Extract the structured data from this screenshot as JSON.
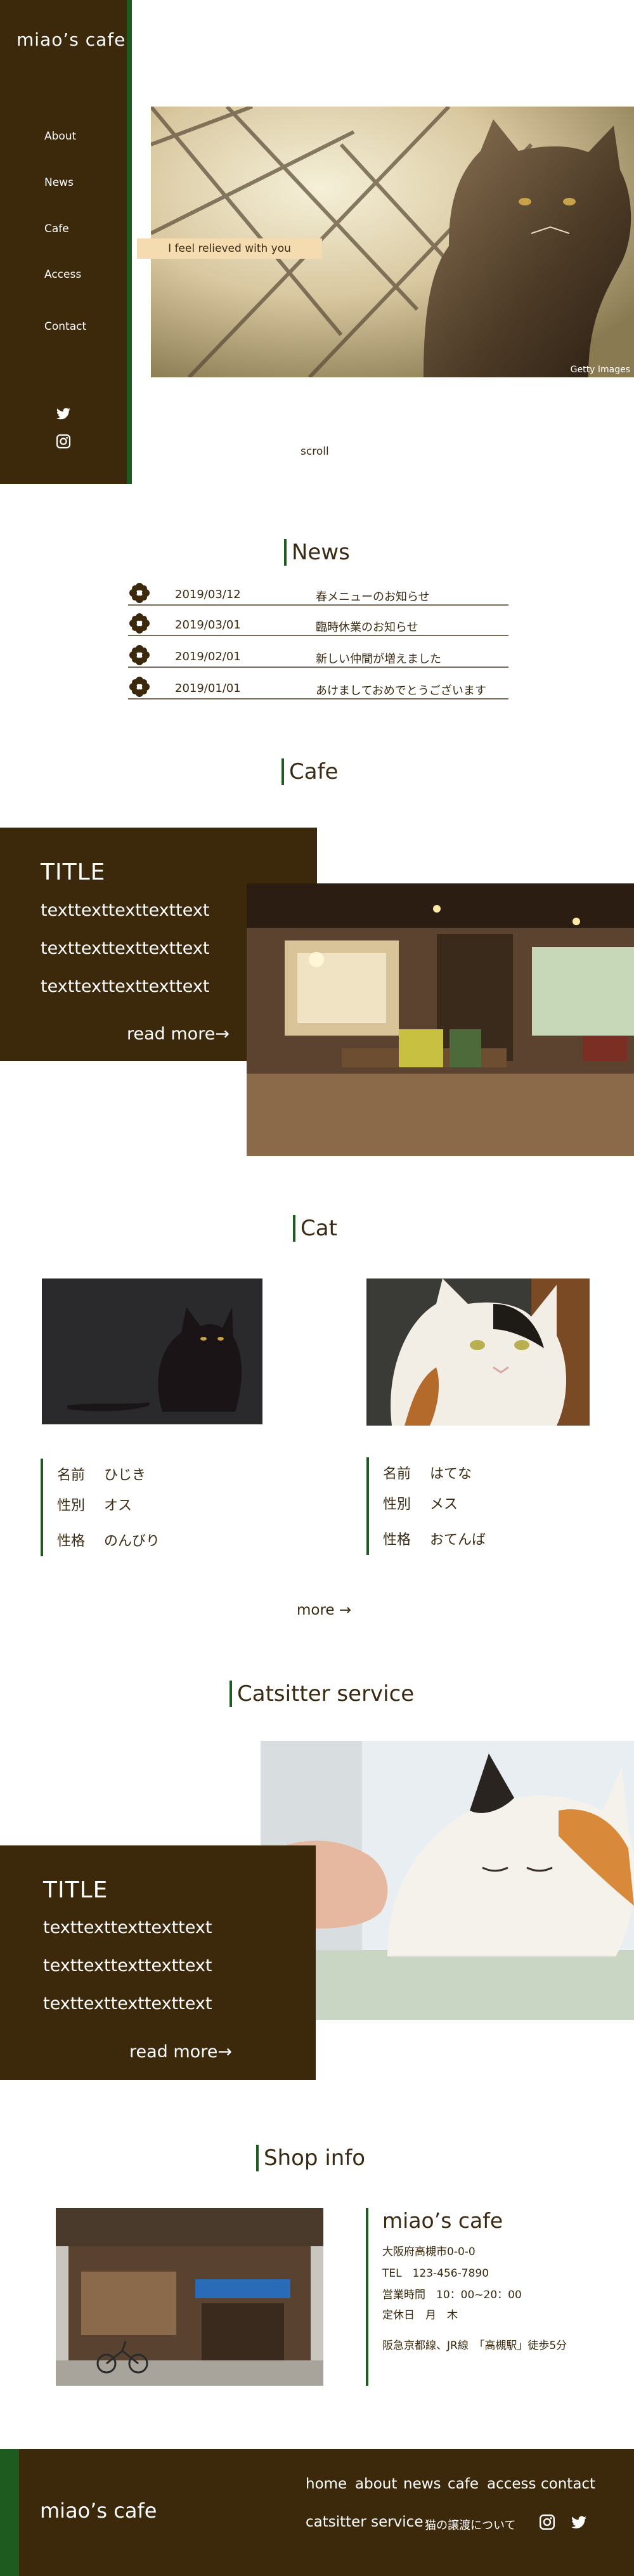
{
  "sidebar": {
    "logo": "miao’s cafe",
    "nav": [
      {
        "label": "About"
      },
      {
        "label": "News"
      },
      {
        "label": "Cafe"
      },
      {
        "label": "Access"
      },
      {
        "label": "Contact"
      }
    ],
    "social": [
      {
        "icon": "twitter-icon"
      },
      {
        "icon": "instagram-icon"
      }
    ]
  },
  "hero": {
    "catch": "I feel relieved with you",
    "credit": "Getty Images",
    "scroll": "scroll"
  },
  "news": {
    "title": "News",
    "items": [
      {
        "date": "2019/03/12",
        "text": "春メニューのお知らせ"
      },
      {
        "date": "2019/03/01",
        "text": "臨時休業のお知らせ"
      },
      {
        "date": "2019/02/01",
        "text": "新しい仲間が増えました"
      },
      {
        "date": "2019/01/01",
        "text": "あけましておめでとうございます"
      }
    ]
  },
  "cafe": {
    "title": "Cafe",
    "box_title": "TITLE",
    "lines": [
      "texttexttexttexttext",
      "texttexttexttexttext",
      "texttexttexttexttext"
    ],
    "more": "read more→"
  },
  "cat": {
    "title": "Cat",
    "cats": [
      {
        "name_label": "名前",
        "name": "ひじき",
        "sex_label": "性別",
        "sex": "オス",
        "trait_label": "性格",
        "trait": "のんびり"
      },
      {
        "name_label": "名前",
        "name": "はてな",
        "sex_label": "性別",
        "sex": "メス",
        "trait_label": "性格",
        "trait": "おてんば"
      }
    ],
    "more": "more →"
  },
  "sitter": {
    "title": "Catsitter service",
    "box_title": "TITLE",
    "lines": [
      "texttexttexttexttext",
      "texttexttexttexttext",
      "texttexttexttexttext"
    ],
    "more": "read more→"
  },
  "shop": {
    "title": "Shop info",
    "name": "miao’s cafe",
    "address": "大阪府高槻市0-0-0",
    "tel": "TEL　123-456-7890",
    "hours": "営業時間　10：00~20：00",
    "closed": "定休日　月　木",
    "access": "阪急京都線、JR線　「高槻駅」徒歩5分"
  },
  "footer": {
    "logo": "miao’s cafe",
    "nav": [
      "home",
      "about",
      "news",
      "cafe",
      "access",
      "contact"
    ],
    "nav2": "catsitter service",
    "small": "猫の譲渡について",
    "social": [
      {
        "icon": "instagram-icon"
      },
      {
        "icon": "twitter-icon"
      }
    ]
  },
  "colors": {
    "brown": "#3c280b",
    "green": "#1d5c1e",
    "cream": "#f4dcb0"
  }
}
